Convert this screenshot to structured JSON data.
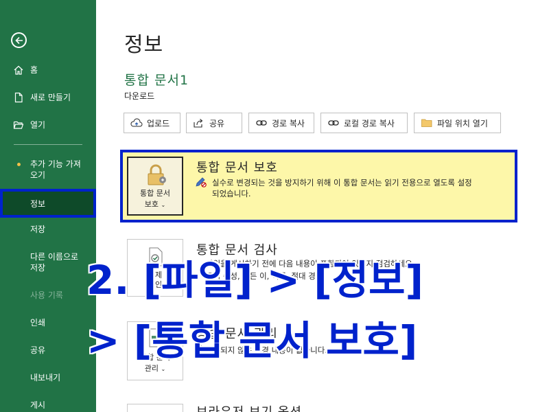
{
  "sidebar": {
    "back_label": "뒤로",
    "items": [
      {
        "label": "홈"
      },
      {
        "label": "새로 만들기"
      },
      {
        "label": "열기"
      },
      {
        "label": "추가 기능 가져오기",
        "line1": "추가 기능 가져",
        "line2": "오기"
      },
      {
        "label": "정보"
      },
      {
        "label": "저장"
      },
      {
        "label": "다른 이름으로 저장",
        "line1": "다른 이름으로",
        "line2": "저장"
      },
      {
        "label": "사용 기록"
      },
      {
        "label": "인쇄"
      },
      {
        "label": "공유"
      },
      {
        "label": "내보내기"
      },
      {
        "label": "게시"
      }
    ],
    "active_item": "정보",
    "colors": {
      "background": "#217346",
      "active": "#0e4a29",
      "highlight_border": "#0022cc"
    }
  },
  "main": {
    "page_title": "정보",
    "doc_title": "통합 문서1",
    "doc_location": "다운로드",
    "buttons": [
      {
        "label": "업로드",
        "icon": "upload-icon"
      },
      {
        "label": "공유",
        "icon": "share-icon"
      },
      {
        "label": "경로 복사",
        "icon": "link-icon"
      },
      {
        "label": "로컬 경로 복사",
        "icon": "link-icon"
      },
      {
        "label": "파일 위치 열기",
        "icon": "folder-icon"
      }
    ],
    "sections": [
      {
        "title": "통합 문서 보호",
        "tile_line1": "통합 문서",
        "tile_line2": "보호",
        "desc_line1": "실수로 변경되는 것을 방지하기 위해 이 통합 문서는 읽기 전용으로 열도록 설정",
        "desc_line2": "되었습니다."
      },
      {
        "title": "통합 문서 검사",
        "tile_line1": "문제",
        "tile_line2": "확인",
        "desc_line1": "파일을 게시하기 전에 다음 내용이 포함되어 있는지 점검하세요.",
        "desc_line2": "문서 속성, 만든 이, 이름, 절대 경로"
      },
      {
        "title": "통합 문서 관리",
        "tile_line1": "통합 문서",
        "tile_line2": "관리",
        "desc_line1": "저장되지 않은 변경 내용이 없습니다."
      },
      {
        "title": "브라우저 보기 옵션"
      }
    ]
  },
  "overlay": {
    "line1": "2. [파일] > [정보]",
    "line2": "> [통합 문서 보호]",
    "color": "#0022cc"
  }
}
